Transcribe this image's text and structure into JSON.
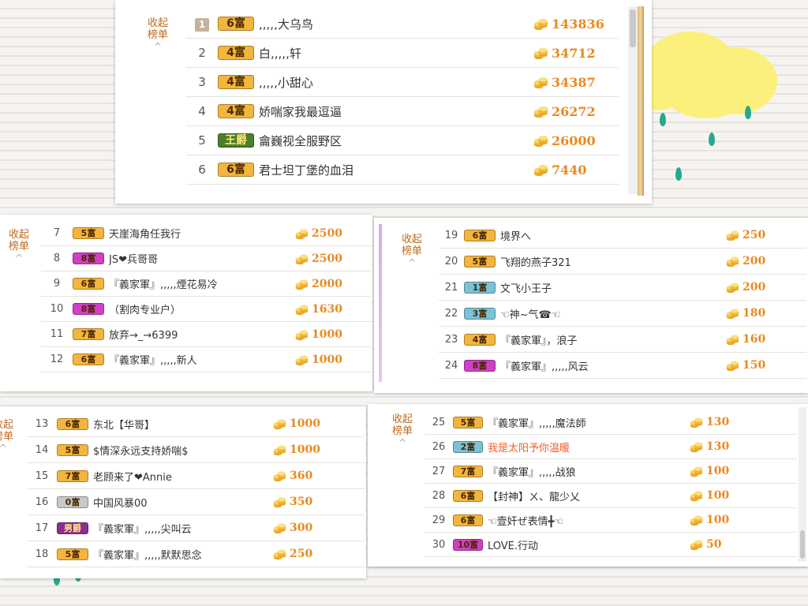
{
  "colors": {
    "accent": "#e98a1f",
    "collapse_text": "#c06a1e",
    "cloud": "#fbf07c",
    "rain": "#25a98c"
  },
  "collapse_label_line1": "收起",
  "collapse_label_line2": "榜单",
  "chevron": "^",
  "panels": [
    {
      "rows": [
        {
          "rank": "1",
          "badge": "6富",
          "badge_color": "#f4b53c",
          "name": ",,,,,大乌鸟",
          "score": "143836"
        },
        {
          "rank": "2",
          "badge": "4富",
          "badge_color": "#f4b53c",
          "name": "白,,,,,轩",
          "score": "34712"
        },
        {
          "rank": "3",
          "badge": "4富",
          "badge_color": "#f4b53c",
          "name": ",,,,,小甜心",
          "score": "34387"
        },
        {
          "rank": "4",
          "badge": "4富",
          "badge_color": "#f4b53c",
          "name": "娇喘家我最逗逼",
          "score": "26272"
        },
        {
          "rank": "5",
          "badge": "王爵",
          "badge_color": "#4c7f2a",
          "name": "龠巍视全服野区",
          "score": "26000"
        },
        {
          "rank": "6",
          "badge": "6富",
          "badge_color": "#f4b53c",
          "name": "君士坦丁堡的血泪",
          "score": "7440"
        }
      ]
    },
    {
      "rows": [
        {
          "rank": "7",
          "badge": "5富",
          "badge_color": "#f4b53c",
          "name": "天崖海角任我行",
          "score": "2500"
        },
        {
          "rank": "8",
          "badge": "8富",
          "badge_color": "#d13fc4",
          "name": "JS❤兵哥哥",
          "score": "2500"
        },
        {
          "rank": "9",
          "badge": "6富",
          "badge_color": "#f4b53c",
          "name": "『義家軍』,,,,,煙花易冷",
          "score": "2000"
        },
        {
          "rank": "10",
          "badge": "8富",
          "badge_color": "#d13fc4",
          "name": "（割肉专业户）",
          "score": "1630"
        },
        {
          "rank": "11",
          "badge": "7富",
          "badge_color": "#f4b53c",
          "name": "放弃→_→6399",
          "score": "1000"
        },
        {
          "rank": "12",
          "badge": "6富",
          "badge_color": "#f4b53c",
          "name": "『義家軍』,,,,,新人",
          "score": "1000"
        }
      ]
    },
    {
      "rows": [
        {
          "rank": "19",
          "badge": "6富",
          "badge_color": "#f4b53c",
          "name": "境界へ",
          "score": "250"
        },
        {
          "rank": "20",
          "badge": "5富",
          "badge_color": "#f4b53c",
          "name": "飞翔的燕子321",
          "score": "200"
        },
        {
          "rank": "21",
          "badge": "1富",
          "badge_color": "#7cc2d6",
          "name": "文飞小王子",
          "score": "200"
        },
        {
          "rank": "22",
          "badge": "3富",
          "badge_color": "#7cc2d6",
          "name": "☜神~气☎☜",
          "score": "180"
        },
        {
          "rank": "23",
          "badge": "4富",
          "badge_color": "#f4b53c",
          "name": "『義家軍』，浪子",
          "score": "160"
        },
        {
          "rank": "24",
          "badge": "8富",
          "badge_color": "#d13fc4",
          "name": "『義家軍』,,,,,风云",
          "score": "150"
        }
      ]
    },
    {
      "rows": [
        {
          "rank": "13",
          "badge": "6富",
          "badge_color": "#f4b53c",
          "name": "东北【华哥】",
          "score": "1000"
        },
        {
          "rank": "14",
          "badge": "5富",
          "badge_color": "#f4b53c",
          "name": "$情深永远支持娇喘$",
          "score": "1000"
        },
        {
          "rank": "15",
          "badge": "7富",
          "badge_color": "#f4b53c",
          "name": "老顾来了❤Annie",
          "score": "360"
        },
        {
          "rank": "16",
          "badge": "0富",
          "badge_color": "#c9c9c9",
          "name": "中国风暴00",
          "score": "350"
        },
        {
          "rank": "17",
          "badge": "男爵",
          "badge_color": "#8a2f8d",
          "name": "『義家軍』,,,,,尖叫云",
          "score": "300"
        },
        {
          "rank": "18",
          "badge": "5富",
          "badge_color": "#f4b53c",
          "name": "『義家軍』,,,,,默默思念",
          "score": "250"
        }
      ]
    },
    {
      "rows": [
        {
          "rank": "25",
          "badge": "5富",
          "badge_color": "#f4b53c",
          "name": "『義家軍』,,,,,魔法師",
          "score": "130"
        },
        {
          "rank": "26",
          "badge": "2富",
          "badge_color": "#7cc2d6",
          "name": "我是太阳予你温暖",
          "score": "130",
          "name_color": "#f0602a"
        },
        {
          "rank": "27",
          "badge": "7富",
          "badge_color": "#f4b53c",
          "name": "『義家軍』,,,,,战狼",
          "score": "100"
        },
        {
          "rank": "28",
          "badge": "6富",
          "badge_color": "#f4b53c",
          "name": "【封神】ㄨ、龍少乂",
          "score": "100"
        },
        {
          "rank": "29",
          "badge": "6富",
          "badge_color": "#f4b53c",
          "name": "☜壹奸ぜ表情╋☜",
          "score": "100"
        },
        {
          "rank": "30",
          "badge": "10富",
          "badge_color": "#d13fc4",
          "name": "LOVE.行动",
          "score": "50"
        }
      ]
    }
  ]
}
